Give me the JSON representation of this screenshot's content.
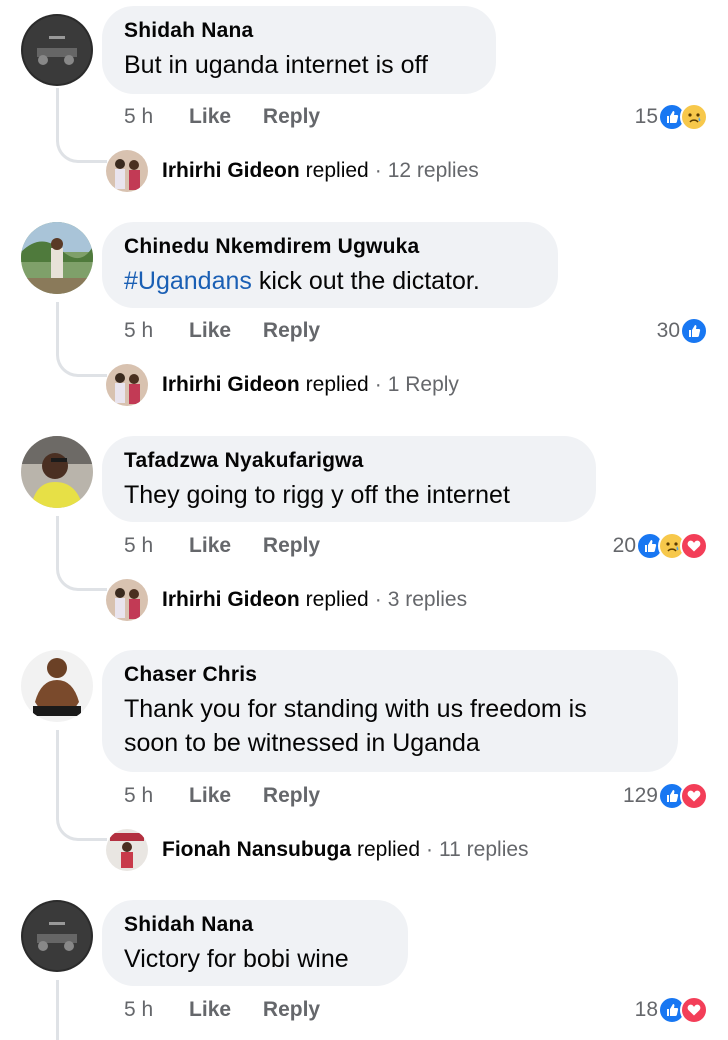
{
  "comments": [
    {
      "author": "Shidah Nana",
      "text": "But in uganda internet is off",
      "time": "5 h",
      "like_label": "Like",
      "reply_label": "Reply",
      "reaction_count": "15",
      "reactions": [
        "like",
        "sad"
      ],
      "replies": {
        "author": "Irhirhi Gideon",
        "verb": "replied",
        "count_label": "12 replies"
      }
    },
    {
      "author": "Chinedu Nkemdirem Ugwuka",
      "hashtag": "#Ugandans",
      "text": " kick out the dictator.",
      "time": "5 h",
      "like_label": "Like",
      "reply_label": "Reply",
      "reaction_count": "30",
      "reactions": [
        "like"
      ],
      "replies": {
        "author": "Irhirhi Gideon",
        "verb": "replied",
        "count_label": "1 Reply"
      }
    },
    {
      "author": "Tafadzwa Nyakufarigwa",
      "text": "They going to rigg y off the internet",
      "time": "5 h",
      "like_label": "Like",
      "reply_label": "Reply",
      "reaction_count": "20",
      "reactions": [
        "like",
        "sad",
        "love"
      ],
      "replies": {
        "author": "Irhirhi Gideon",
        "verb": "replied",
        "count_label": "3 replies"
      }
    },
    {
      "author": "Chaser Chris",
      "text_line1": "Thank you for standing with us freedom is",
      "text_line2": "soon to be witnessed in Uganda",
      "time": "5 h",
      "like_label": "Like",
      "reply_label": "Reply",
      "reaction_count": "129",
      "reactions": [
        "like",
        "love"
      ],
      "replies": {
        "author": "Fionah Nansubuga",
        "verb": "replied",
        "count_label": "11 replies"
      }
    },
    {
      "author": "Shidah Nana",
      "text": "Victory for bobi wine",
      "time": "5 h",
      "like_label": "Like",
      "reply_label": "Reply",
      "reaction_count": "18",
      "reactions": [
        "like",
        "love"
      ]
    }
  ],
  "separator": "·",
  "colors": {
    "bubble": "#f0f2f5",
    "secondary_text": "#65676b",
    "hashtag": "#1a5fb4",
    "like": "#1877f2",
    "love": "#f33e58",
    "sad": "#f7c84b"
  }
}
